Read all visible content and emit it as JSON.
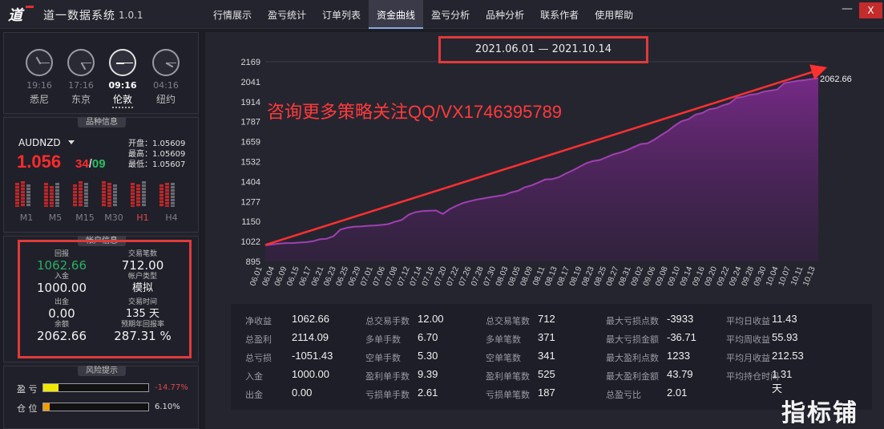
{
  "app": {
    "logo": "道",
    "title": "道一数据系统",
    "version": "1.0.1"
  },
  "nav": {
    "tabs": [
      "行情展示",
      "盈亏统计",
      "订单列表",
      "资金曲线",
      "盈亏分析",
      "品种分析",
      "联系作者",
      "使用帮助"
    ],
    "active": 3
  },
  "window": {
    "minimize": "—",
    "close": "X"
  },
  "clocks": [
    {
      "time": "19:16",
      "city": "悉尼",
      "active": false
    },
    {
      "time": "17:16",
      "city": "东京",
      "active": false
    },
    {
      "time": "09:16",
      "city": "伦敦",
      "active": true
    },
    {
      "time": "04:16",
      "city": "纽约",
      "active": false
    }
  ],
  "symbol": {
    "section_label": "品种信息",
    "name": "AUDNZD",
    "price_main": "1.056",
    "price_a": "34",
    "slash": "/",
    "price_b": "09",
    "open": "开盘：1.05609",
    "high": "最高：1.05609",
    "low": "最低：1.05607",
    "timeframes": [
      {
        "label": "M1",
        "red": false
      },
      {
        "label": "M5",
        "red": false
      },
      {
        "label": "M15",
        "red": false
      },
      {
        "label": "M30",
        "red": false
      },
      {
        "label": "H1",
        "red": true
      },
      {
        "label": "H4",
        "red": false
      }
    ]
  },
  "account": {
    "section_label": "帐户信息",
    "profit_label": "回报",
    "profit": "1062.66",
    "deposit_label": "入金",
    "deposit": "1000.00",
    "withdraw_label": "出金",
    "withdraw": "0.00",
    "balance_label": "余额",
    "balance": "2062.66",
    "trades_label": "交易笔数",
    "trades": "712.00",
    "type_label": "帐户类型",
    "type": "模拟",
    "days_label": "交易时间",
    "days": "135 天",
    "annual_label": "预期年回报率",
    "annual": "287.31 %"
  },
  "risk": {
    "section_label": "风险提示",
    "pl_label": "盈 亏",
    "pl_value": "-14.77%",
    "pl_fill": 0.1477,
    "pos_label": "仓 位",
    "pos_value": "6.10%",
    "pos_fill": 0.061,
    "pl_color": "#f0e800",
    "pos_color": "#f0a000"
  },
  "chart_header": {
    "date_range": "2021.06.01 — 2021.10.14",
    "promo": "咨询更多策略关注QQ/VX1746395789"
  },
  "chart_data": {
    "type": "area",
    "title": "",
    "xlabel": "",
    "ylabel": "",
    "ylim": [
      895,
      2169
    ],
    "yticks": [
      895,
      1022,
      1150,
      1277,
      1404,
      1532,
      1659,
      1787,
      1914,
      2041,
      2169
    ],
    "xticks": [
      "06.01",
      "06.04",
      "06.09",
      "06.15",
      "06.17",
      "06.21",
      "06.23",
      "06.25",
      "06.29",
      "07.01",
      "07.06",
      "07.08",
      "07.12",
      "07.14",
      "07.16",
      "07.20",
      "07.22",
      "07.26",
      "07.28",
      "07.30",
      "08.03",
      "08.05",
      "08.09",
      "08.11",
      "08.13",
      "08.17",
      "08.19",
      "08.23",
      "08.25",
      "08.27",
      "08.31",
      "09.02",
      "09.06",
      "09.08",
      "09.10",
      "09.14",
      "09.16",
      "09.20",
      "09.22",
      "09.24",
      "09.28",
      "09.30",
      "10.04",
      "10.07",
      "10.11",
      "10.13"
    ],
    "end_label": "2062.66",
    "color": "#a040b0",
    "series": [
      {
        "values": [
          998,
          1003,
          1008,
          1012,
          1012,
          1015,
          1018,
          1024,
          1036,
          1040,
          1056,
          1098,
          1110,
          1116,
          1118,
          1122,
          1124,
          1128,
          1133,
          1148,
          1160,
          1193,
          1209,
          1216,
          1219,
          1220,
          1198,
          1228,
          1250,
          1268,
          1280,
          1290,
          1297,
          1305,
          1312,
          1318,
          1335,
          1345,
          1368,
          1380,
          1398,
          1418,
          1420,
          1432,
          1455,
          1475,
          1498,
          1522,
          1535,
          1542,
          1560,
          1578,
          1590,
          1605,
          1625,
          1644,
          1648,
          1672,
          1702,
          1728,
          1762,
          1790,
          1802,
          1832,
          1842,
          1865,
          1872,
          1890,
          1904,
          1938,
          1945,
          1958,
          1964,
          1978,
          1985,
          1992,
          2032,
          2040,
          2047,
          2052,
          2059,
          2062.66
        ]
      }
    ]
  },
  "stats": [
    [
      {
        "k": "净收益",
        "v": "1062.66"
      },
      {
        "k": "总盈利",
        "v": "2114.09"
      },
      {
        "k": "总亏损",
        "v": "-1051.43"
      },
      {
        "k": "入金",
        "v": "1000.00"
      },
      {
        "k": "出金",
        "v": "0.00"
      }
    ],
    [
      {
        "k": "总交易手数",
        "v": "12.00"
      },
      {
        "k": "多单手数",
        "v": "6.70"
      },
      {
        "k": "空单手数",
        "v": "5.30"
      },
      {
        "k": "盈利单手数",
        "v": "9.39"
      },
      {
        "k": "亏损单手数",
        "v": "2.61"
      }
    ],
    [
      {
        "k": "总交易笔数",
        "v": "712"
      },
      {
        "k": "多单笔数",
        "v": "371"
      },
      {
        "k": "空单笔数",
        "v": "341"
      },
      {
        "k": "盈利单笔数",
        "v": "525"
      },
      {
        "k": "亏损单笔数",
        "v": "187"
      }
    ],
    [
      {
        "k": "最大亏损点数",
        "v": "-3933"
      },
      {
        "k": "最大亏损金额",
        "v": "-36.71"
      },
      {
        "k": "最大盈利点数",
        "v": "1233"
      },
      {
        "k": "最大盈利金额",
        "v": "43.79"
      },
      {
        "k": "总盈亏比",
        "v": "2.01"
      }
    ],
    [
      {
        "k": "平均日收益",
        "v": "11.43"
      },
      {
        "k": "平均周收益",
        "v": "55.93"
      },
      {
        "k": "平均月收益",
        "v": "212.53"
      },
      {
        "k": "平均持仓时间",
        "v": "1.31天"
      }
    ]
  ],
  "watermark": "指标铺"
}
